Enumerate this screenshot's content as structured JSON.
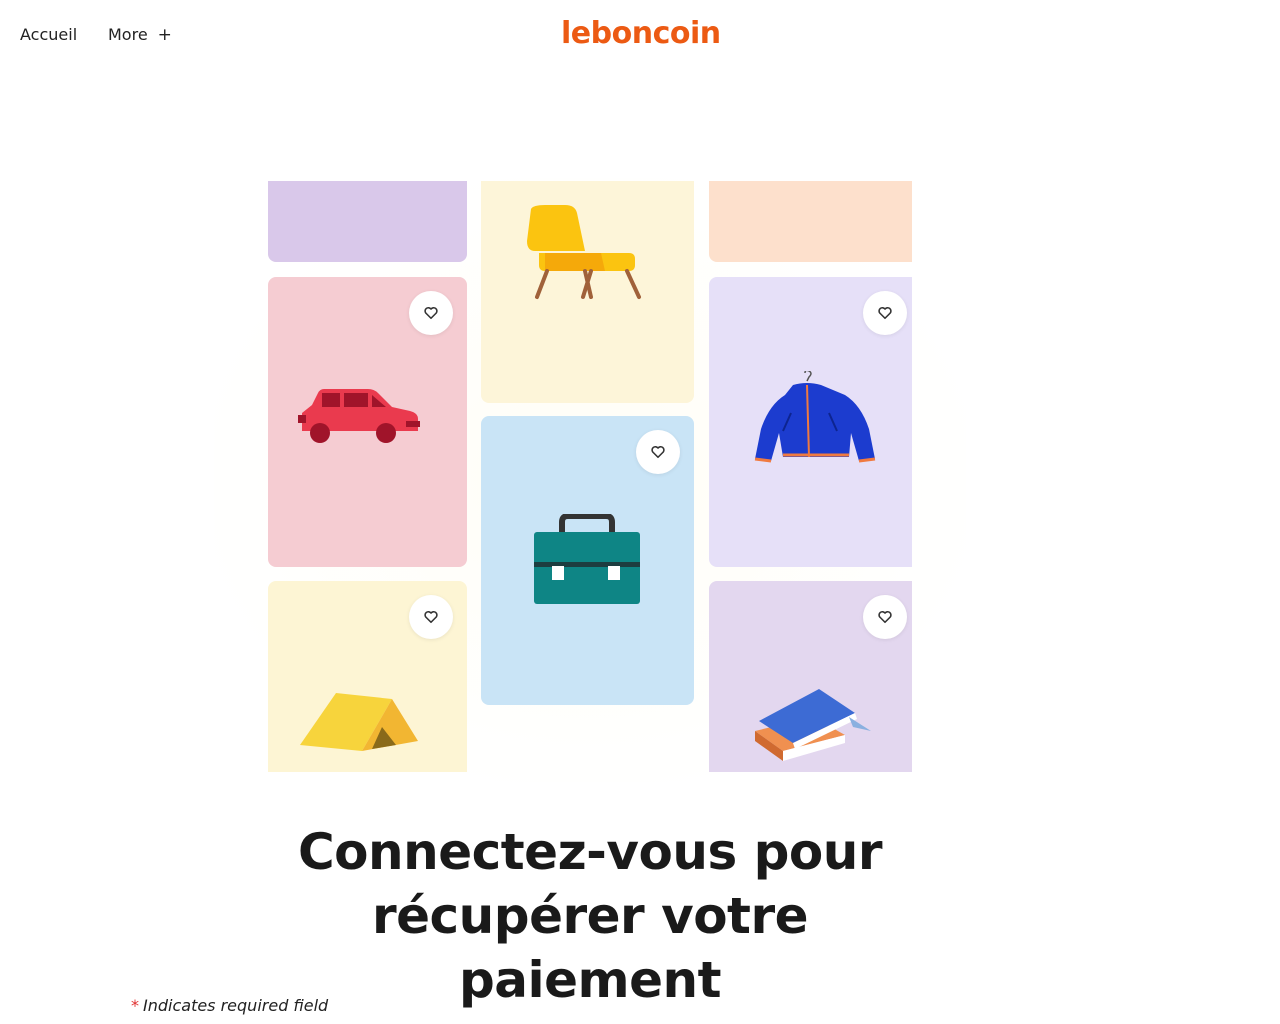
{
  "nav": {
    "home_label": "Accueil",
    "more_label": "More",
    "more_icon": "+"
  },
  "brand": {
    "logo_text": "leboncoin",
    "color": "#ec5a13"
  },
  "hero": {
    "cards": [
      {
        "item": "empty",
        "color": "#d9c8ea",
        "favorite": false
      },
      {
        "item": "chair-icon",
        "color": "#fdf5d9",
        "favorite": false
      },
      {
        "item": "empty",
        "color": "#fde0cc",
        "favorite": false
      },
      {
        "item": "car-icon",
        "color": "#f5ccd2",
        "favorite": true
      },
      {
        "item": "briefcase-icon",
        "color": "#c9e4f6",
        "favorite": true
      },
      {
        "item": "jacket-icon",
        "color": "#e6e0f8",
        "favorite": true
      },
      {
        "item": "tent-icon",
        "color": "#fdf5d4",
        "favorite": true
      },
      {
        "item": "books-icon",
        "color": "#e3d7ef",
        "favorite": true
      }
    ]
  },
  "headline": {
    "line1": "Connectez-vous pour",
    "line2": "récupérer votre paiement"
  },
  "form": {
    "required_marker": "*",
    "required_note": "Indicates required field",
    "required_color": "#e03030"
  }
}
